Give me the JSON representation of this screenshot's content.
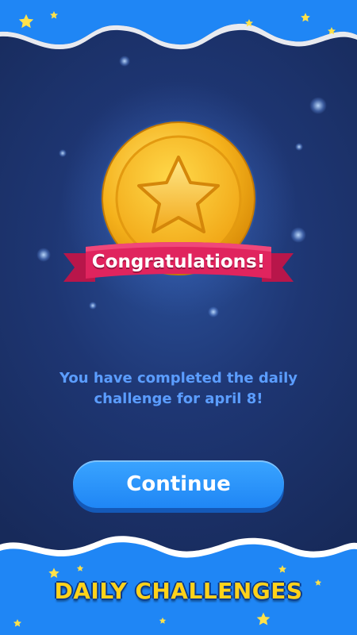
{
  "dialog": {
    "banner_text": "Congratulations!",
    "message": "You have completed the daily challenge for april 8!",
    "continue_label": "Continue"
  },
  "footer": {
    "title": "DAILY CHALLENGES"
  },
  "colors": {
    "background": "#1e3673",
    "wave_blue": "#1f86f5",
    "banner_red": "#e0245e",
    "coin_gold": "#f5b21c",
    "message_blue": "#5b9dff",
    "footer_yellow": "#ffd21a"
  },
  "icons": [
    "star-medal-icon",
    "star-icon"
  ]
}
